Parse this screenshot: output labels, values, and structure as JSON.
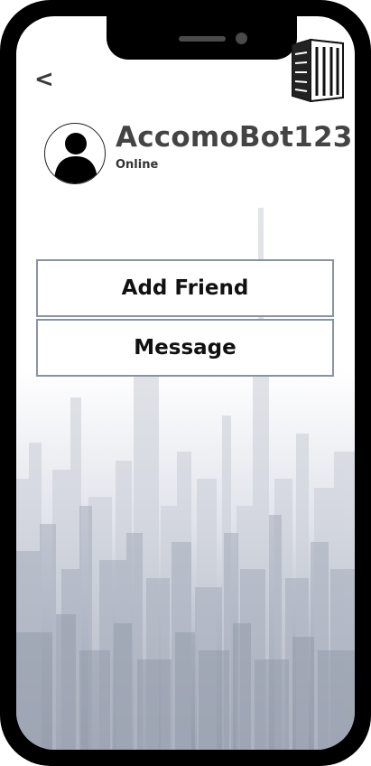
{
  "header": {
    "back_label": "<",
    "logo_icon": "building-icon"
  },
  "profile": {
    "name": "AccomoBot123",
    "status": "Online",
    "avatar_icon": "user-avatar-icon"
  },
  "actions": {
    "add_friend_label": "Add Friend",
    "message_label": "Message"
  },
  "colors": {
    "frame": "#000000",
    "button_border": "#8a93a6",
    "name_text": "#444444",
    "skyline": "#a6adbb"
  }
}
